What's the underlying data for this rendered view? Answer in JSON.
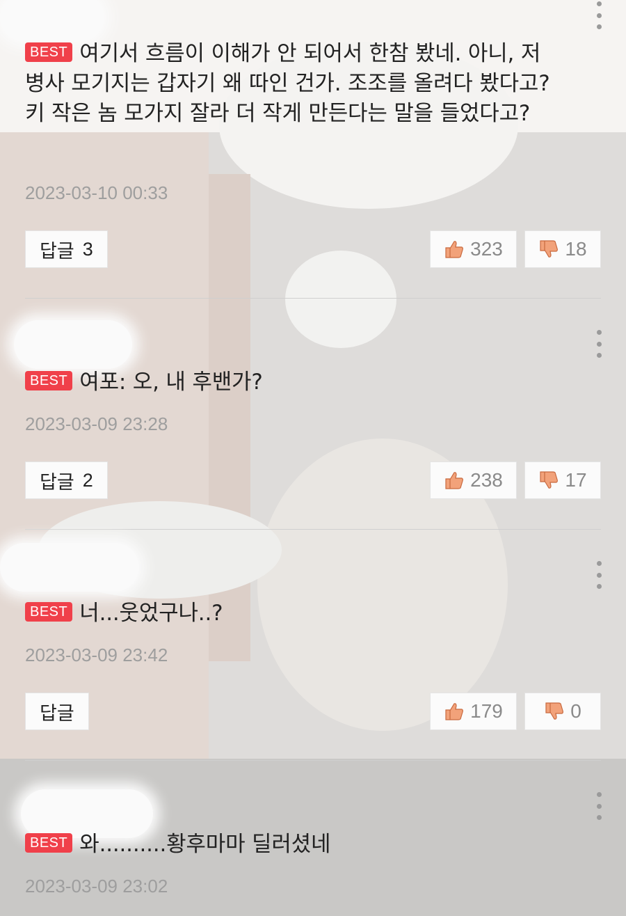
{
  "comments": [
    {
      "badge": "BEST",
      "text": "여기서 흐름이 이해가 안 되어서 한참 봤네. 아니, 저 병사 모기지는 갑자기 왜 따인 건가. 조조를 올려다 봤다고? 키 작은 놈 모가지 잘라 더 작게 만든다는 말을 들었다고?",
      "date": "2023-03-10 00:33",
      "reply_label": "답글",
      "reply_count": "3",
      "likes": "323",
      "dislikes": "18"
    },
    {
      "badge": "BEST",
      "text": "여포: 오, 내 후밴가?",
      "date": "2023-03-09 23:28",
      "reply_label": "답글",
      "reply_count": "2",
      "likes": "238",
      "dislikes": "17"
    },
    {
      "badge": "BEST",
      "text": "너...웃었구나..?",
      "date": "2023-03-09 23:42",
      "reply_label": "답글",
      "reply_count": "",
      "likes": "179",
      "dislikes": "0"
    },
    {
      "badge": "BEST",
      "text": "와..........황후마마 딜러셨네",
      "date": "2023-03-09 23:02"
    }
  ],
  "icons": {
    "more": "more-vertical-icon",
    "like": "thumbs-up-icon",
    "dislike": "thumbs-down-icon"
  },
  "colors": {
    "badge": "#f0404a",
    "thumb": "#f2a27a"
  }
}
